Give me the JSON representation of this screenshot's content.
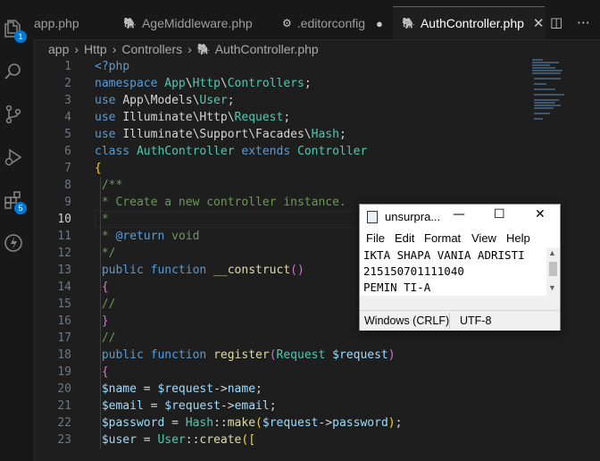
{
  "activity_bar": {
    "items": [
      {
        "name": "explorer-icon",
        "badge": "1"
      },
      {
        "name": "search-icon"
      },
      {
        "name": "source-control-icon"
      },
      {
        "name": "run-debug-icon"
      },
      {
        "name": "extensions-icon",
        "badge": "5"
      },
      {
        "name": "remote-icon"
      }
    ],
    "badge_color": "#0078d4"
  },
  "tabs": [
    {
      "label": "app.php",
      "icon": "php-icon"
    },
    {
      "label": "AgeMiddleware.php",
      "icon": "php-icon"
    },
    {
      "label": ".editorconfig",
      "icon": "gear-icon",
      "modified": true
    },
    {
      "label": "AuthController.php",
      "icon": "php-icon",
      "active": true
    }
  ],
  "tab_close_glyph": "✕",
  "modified_glyph": "●",
  "breadcrumb": [
    "app",
    "Http",
    "Controllers",
    "AuthController.php"
  ],
  "editor": {
    "current_line": "10",
    "line_numbers": [
      "1",
      "2",
      "3",
      "4",
      "5",
      "6",
      "7",
      "8",
      "9",
      "10",
      "11",
      "12",
      "13",
      "14",
      "15",
      "16",
      "17",
      "18",
      "19",
      "20",
      "21",
      "22",
      "23"
    ],
    "lines": [
      [
        [
          "k",
          "<?php"
        ]
      ],
      [
        [
          "k",
          "namespace "
        ],
        [
          "t",
          "App"
        ],
        [
          "p",
          "\\"
        ],
        [
          "t",
          "Http"
        ],
        [
          "p",
          "\\"
        ],
        [
          "t",
          "Controllers"
        ],
        [
          "p",
          ";"
        ]
      ],
      [
        [
          "k",
          "use "
        ],
        [
          "p",
          "App\\Models\\"
        ],
        [
          "t",
          "User"
        ],
        [
          "p",
          ";"
        ]
      ],
      [
        [
          "k",
          "use "
        ],
        [
          "p",
          "Illuminate\\Http\\"
        ],
        [
          "t",
          "Request"
        ],
        [
          "p",
          ";"
        ]
      ],
      [
        [
          "k",
          "use "
        ],
        [
          "p",
          "Illuminate\\Support\\Facades\\"
        ],
        [
          "t",
          "Hash"
        ],
        [
          "p",
          ";"
        ]
      ],
      [
        [
          "k",
          "class "
        ],
        [
          "t",
          "AuthController "
        ],
        [
          "k",
          "extends "
        ],
        [
          "t",
          "Controller"
        ]
      ],
      [
        [
          "br1",
          "{"
        ]
      ],
      [
        [
          "c",
          " /**"
        ]
      ],
      [
        [
          "c",
          " * Create a new controller instance."
        ]
      ],
      [
        [
          "c",
          " *"
        ]
      ],
      [
        [
          "c",
          " * "
        ],
        [
          "k",
          "@return"
        ],
        [
          "c",
          " void"
        ]
      ],
      [
        [
          "c",
          " */"
        ]
      ],
      [
        [
          "k",
          " public function "
        ],
        [
          "f",
          "__construct"
        ],
        [
          "br2",
          "()"
        ]
      ],
      [
        [
          "br2",
          " {"
        ]
      ],
      [
        [
          "c",
          " //"
        ]
      ],
      [
        [
          "br2",
          " }"
        ]
      ],
      [
        [
          "c",
          " //"
        ]
      ],
      [
        [
          "k",
          " public function "
        ],
        [
          "f",
          "register"
        ],
        [
          "br2",
          "("
        ],
        [
          "t",
          "Request "
        ],
        [
          "v",
          "$request"
        ],
        [
          "br2",
          ")"
        ]
      ],
      [
        [
          "br2",
          " {"
        ]
      ],
      [
        [
          "v",
          " $name"
        ],
        [
          "p",
          " = "
        ],
        [
          "v",
          "$request"
        ],
        [
          "p",
          "->"
        ],
        [
          "v",
          "name"
        ],
        [
          "p",
          ";"
        ]
      ],
      [
        [
          "v",
          " $email"
        ],
        [
          "p",
          " = "
        ],
        [
          "v",
          "$request"
        ],
        [
          "p",
          "->"
        ],
        [
          "v",
          "email"
        ],
        [
          "p",
          ";"
        ]
      ],
      [
        [
          "v",
          " $password"
        ],
        [
          "p",
          " = "
        ],
        [
          "t",
          "Hash"
        ],
        [
          "p",
          "::"
        ],
        [
          "f",
          "make"
        ],
        [
          "br1",
          "("
        ],
        [
          "v",
          "$request"
        ],
        [
          "p",
          "->"
        ],
        [
          "v",
          "password"
        ],
        [
          "br1",
          ")"
        ],
        [
          "p",
          ";"
        ]
      ],
      [
        [
          "v",
          " $user"
        ],
        [
          "p",
          " = "
        ],
        [
          "t",
          "User"
        ],
        [
          "p",
          "::"
        ],
        [
          "f",
          "create"
        ],
        [
          "br1",
          "(["
        ]
      ]
    ]
  },
  "notepad": {
    "title": "unsurpra...",
    "menu": [
      "File",
      "Edit",
      "Format",
      "View",
      "Help"
    ],
    "text_lines": [
      "IKTA SHAPA VANIA ADRISTI",
      "215150701111040",
      "PEMIN TI-A"
    ],
    "status": {
      "line_ending": "Windows (CRLF)",
      "encoding": "UTF-8"
    },
    "controls": {
      "minimize": "—",
      "maximize": "☐",
      "close": "✕"
    }
  },
  "toolbar": {
    "split_glyph": "◫",
    "more_glyph": "⋯"
  }
}
